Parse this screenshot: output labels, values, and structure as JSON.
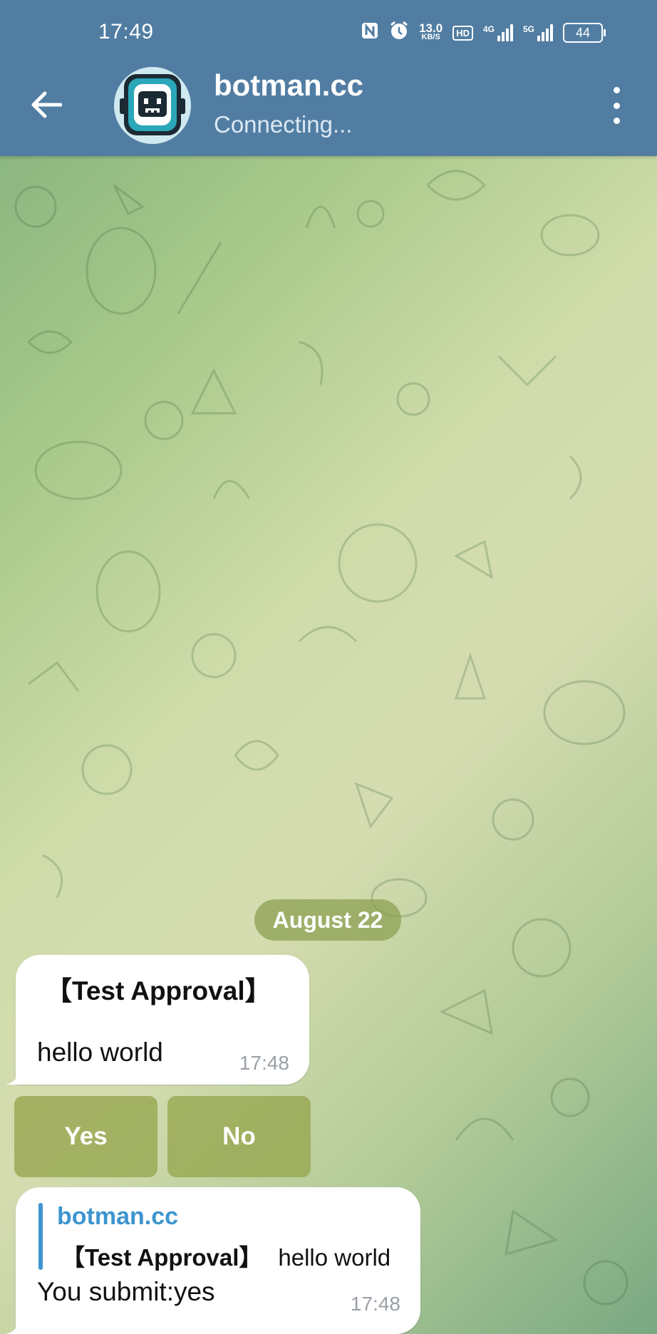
{
  "status_bar": {
    "time": "17:49",
    "net_speed_value": "13.0",
    "net_speed_unit": "KB/S",
    "hd_label": "HD",
    "sim1_label": "4G",
    "sim2_label": "5G",
    "battery": "44"
  },
  "header": {
    "title": "botman.cc",
    "subtitle": "Connecting...",
    "back_icon": "arrow-left-icon",
    "menu_icon": "more-vertical-icon"
  },
  "chat": {
    "date_label": "August 22",
    "messages": [
      {
        "title": "【Test Approval】",
        "body": "hello world",
        "time": "17:48"
      },
      {
        "reply_name": "botman.cc",
        "reply_title": "【Test Approval】",
        "reply_body": "hello world",
        "body": "You submit:yes",
        "time": "17:48"
      }
    ],
    "inline_keyboard": {
      "yes_label": "Yes",
      "no_label": "No"
    }
  },
  "colors": {
    "header_bg": "#517da2",
    "accent_blue": "#3e95cf",
    "keyboard_button": "#96a54e"
  }
}
